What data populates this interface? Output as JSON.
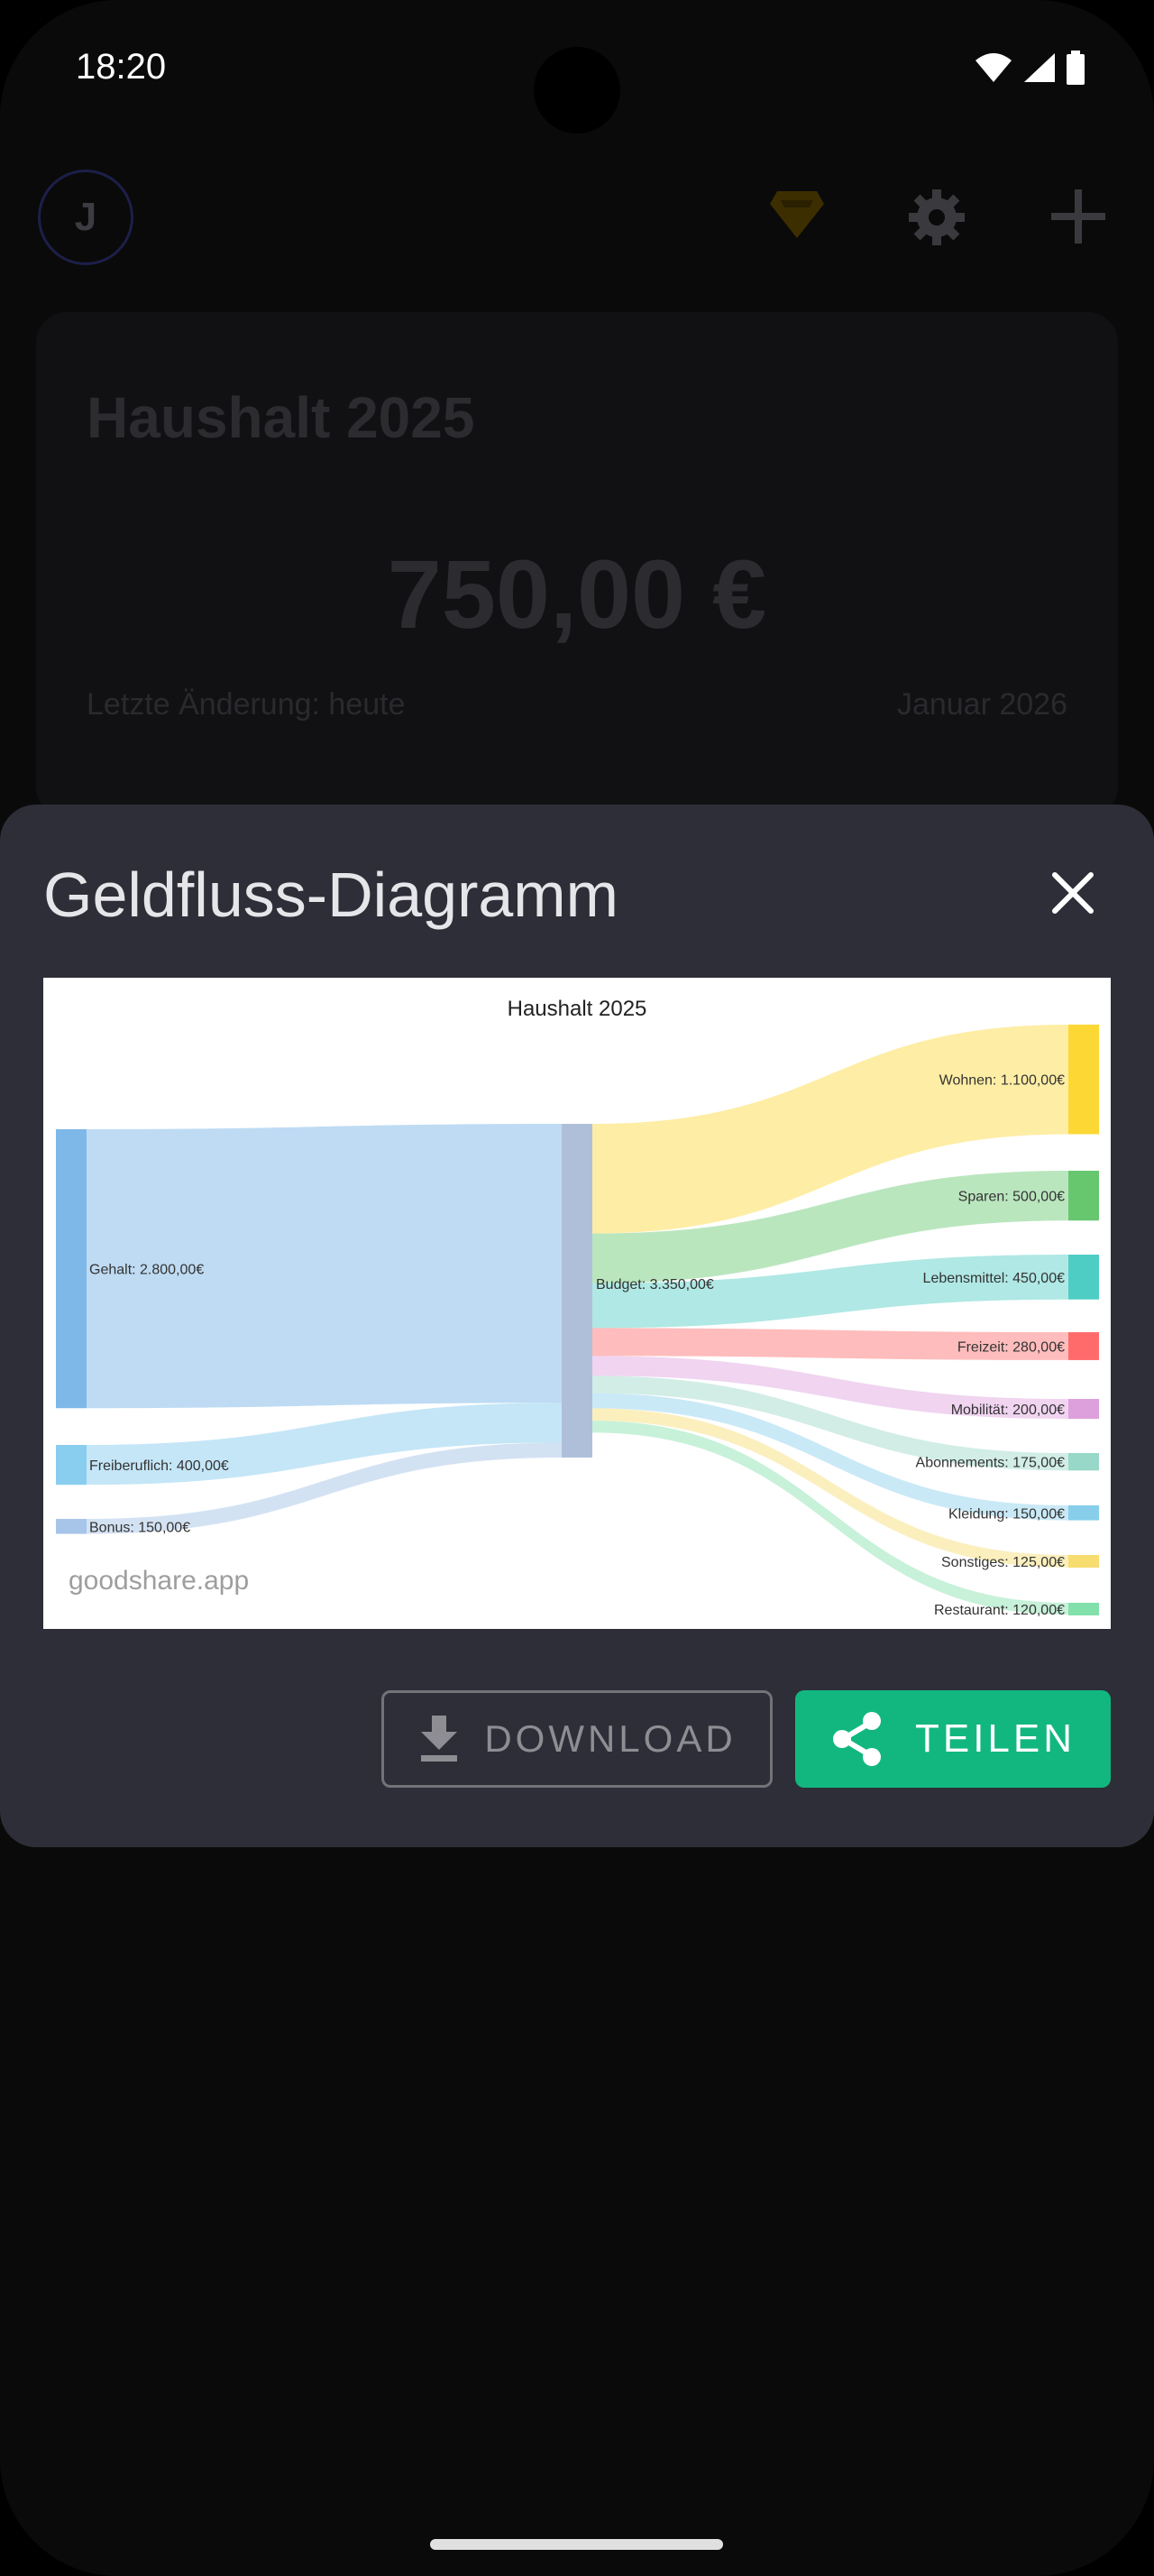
{
  "status_bar": {
    "time": "18:20"
  },
  "app": {
    "avatar_letter": "J",
    "budget": {
      "title": "Haushalt 2025",
      "amount": "750,00 €",
      "last_changed": "Letzte Änderung: heute",
      "month": "Januar 2026"
    }
  },
  "sheet": {
    "title": "Geldfluss-Diagramm",
    "download_label": "DOWNLOAD",
    "share_label": "TEILEN"
  },
  "chart_data": {
    "type": "sankey",
    "title": "Haushalt 2025",
    "watermark": "goodshare.app",
    "center": {
      "name": "Budget",
      "label": "Budget: 3.350,00€",
      "value": 3350,
      "color": "#b0bfd9"
    },
    "sources": [
      {
        "name": "Gehalt",
        "label": "Gehalt: 2.800,00€",
        "value": 2800,
        "color": "#7db8e8"
      },
      {
        "name": "Freiberuflich",
        "label": "Freiberuflich: 400,00€",
        "value": 400,
        "color": "#89cdef"
      },
      {
        "name": "Bonus",
        "label": "Bonus: 150,00€",
        "value": 150,
        "color": "#a7c5e8"
      }
    ],
    "targets": [
      {
        "name": "Wohnen",
        "label": "Wohnen: 1.100,00€",
        "value": 1100,
        "color": "#fdd835"
      },
      {
        "name": "Sparen",
        "label": "Sparen: 500,00€",
        "value": 500,
        "color": "#66c76f"
      },
      {
        "name": "Lebensmittel",
        "label": "Lebensmittel: 450,00€",
        "value": 450,
        "color": "#4ecdc4"
      },
      {
        "name": "Freizeit",
        "label": "Freizeit: 280,00€",
        "value": 280,
        "color": "#ff6b6b"
      },
      {
        "name": "Mobilität",
        "label": "Mobilität: 200,00€",
        "value": 200,
        "color": "#dda0dd"
      },
      {
        "name": "Abonnements",
        "label": "Abonnements: 175,00€",
        "value": 175,
        "color": "#98d8c8"
      },
      {
        "name": "Kleidung",
        "label": "Kleidung: 150,00€",
        "value": 150,
        "color": "#87ceeb"
      },
      {
        "name": "Sonstiges",
        "label": "Sonstiges: 125,00€",
        "value": 125,
        "color": "#f7dc6f"
      },
      {
        "name": "Restaurant",
        "label": "Restaurant: 120,00€",
        "value": 120,
        "color": "#82e0aa"
      }
    ]
  }
}
